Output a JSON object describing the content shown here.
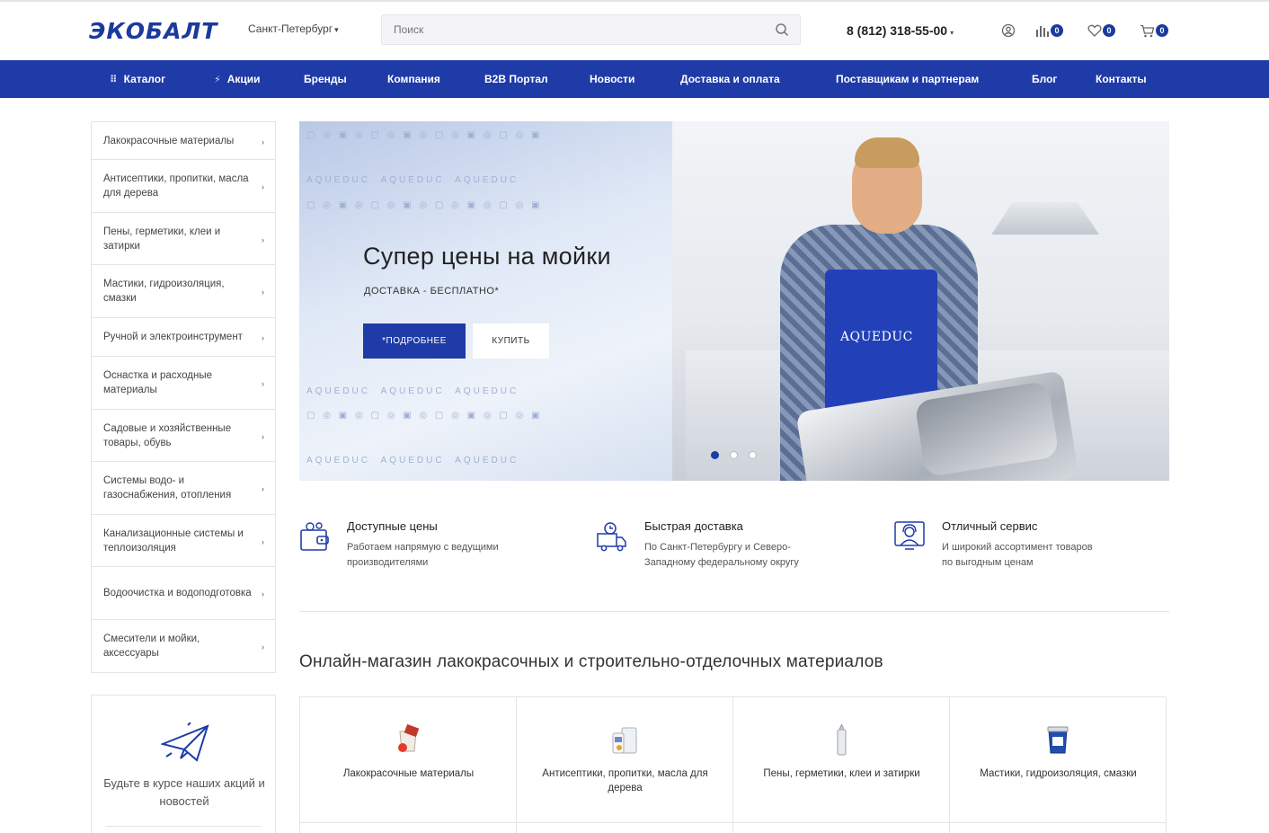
{
  "header": {
    "logo_text": "ЭКОБАЛТ",
    "city": "Санкт-Петербург",
    "search_placeholder": "Поиск",
    "phone": "8 (812) 318-55-00",
    "compare_count": "0",
    "favorites_count": "0",
    "cart_count": "0"
  },
  "nav": {
    "items": [
      {
        "label": "Каталог",
        "icon": "grid-icon"
      },
      {
        "label": "Акции",
        "icon": "lightning-icon"
      },
      {
        "label": "Бренды"
      },
      {
        "label": "Компания"
      },
      {
        "label": "B2B Портал"
      },
      {
        "label": "Новости"
      },
      {
        "label": "Доставка и оплата"
      },
      {
        "label": "Поставщикам и партнерам"
      },
      {
        "label": "Блог"
      },
      {
        "label": "Контакты"
      }
    ]
  },
  "sidebar": {
    "items": [
      "Лакокрасочные материалы",
      "Антисептики, пропитки, масла для дерева",
      "Пены, герметики, клеи и затирки",
      "Мастики, гидроизоляция, смазки",
      "Ручной и электроинструмент",
      "Оснастка и расходные материалы",
      "Садовые и хозяйственные товары, обувь",
      "Системы водо- и газоснабжения, отопления",
      "Канализационные системы и теплоизоляция",
      "Водоочистка и водоподготовка",
      "Смесители и мойки, аксессуары"
    ]
  },
  "subscribe": {
    "text": "Будьте в курсе наших акций и новостей"
  },
  "banner": {
    "title": "Супер цены на мойки",
    "subtitle": "ДОСТАВКА - БЕСПЛАТНО*",
    "btn_more": "*ПОДРОБНЕЕ",
    "btn_buy": "КУПИТЬ",
    "brand": "AQUEDUC",
    "slides": 3,
    "active_slide": 1
  },
  "advantages": [
    {
      "title": "Доступные цены",
      "text": "Работаем напрямую с ведущими производителями",
      "icon": "wallet-icon"
    },
    {
      "title": "Быстрая доставка",
      "text": "По Санкт-Петербургу и Северо-Западному федеральному округу",
      "icon": "truck-icon"
    },
    {
      "title": "Отличный сервис",
      "text": "И широкий ассортимент товаров по выгодным ценам",
      "icon": "support-icon"
    }
  ],
  "catalog": {
    "title": "Онлайн-магазин лакокрасочных и строительно-отделочных материалов",
    "items": [
      {
        "label": "Лакокрасочные материалы",
        "icon": "paint-bucket-icon"
      },
      {
        "label": "Антисептики, пропитки, масла для дерева",
        "icon": "canister-icon"
      },
      {
        "label": "Пены, герметики, клеи и затирки",
        "icon": "sealant-tube-icon"
      },
      {
        "label": "Мастики, гидроизоляция, смазки",
        "icon": "mastic-bucket-icon"
      }
    ]
  },
  "colors": {
    "brand_blue": "#1f3ba8",
    "logo_blue": "#1c3a9e"
  }
}
